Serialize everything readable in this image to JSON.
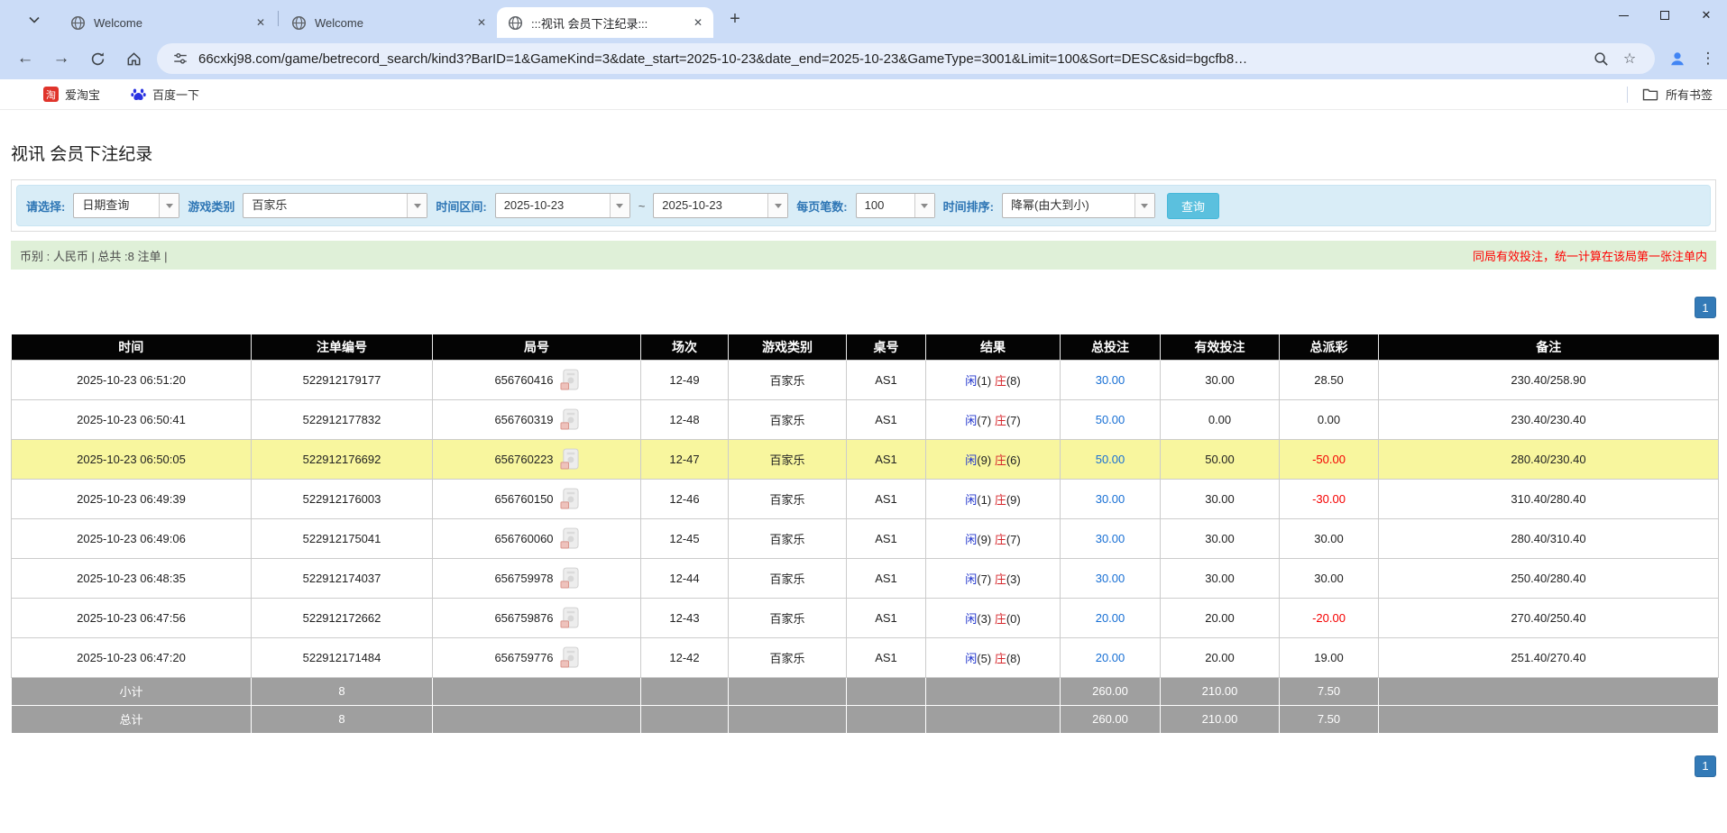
{
  "colors": {
    "player_blue": "#2135cd",
    "banker_red": "#d6262b",
    "amount_blue": "#176fd4",
    "negative_red": "#f50000",
    "highlight_yellow": "#f8f69e",
    "search_button_blue": "#5bc0de",
    "pagination_blue": "#337ab7",
    "filter_bar_blue": "#d9edf7",
    "info_bar_green": "#dff0d8",
    "header_black": "#040404"
  },
  "browser": {
    "tabs": [
      "Welcome",
      "Welcome",
      ":::视讯 会员下注纪录:::"
    ],
    "url": "66cxkj98.com/game/betrecord_search/kind3?BarID=1&GameKind=3&date_start=2025-10-23&date_end=2025-10-23&GameType=3001&Limit=100&Sort=DESC&sid=bgcfb8…",
    "bookmarks": {
      "items": [
        "爱淘宝",
        "百度一下"
      ],
      "all_bookmarks": "所有书签"
    }
  },
  "page": {
    "title": "视讯 会员下注纪录",
    "filter": {
      "select_label": "请选择:",
      "select_value": "日期查询",
      "game_type_label": "游戏类别",
      "game_type_value": "百家乐",
      "time_range_label": "时间区间:",
      "date_start": "2025-10-23",
      "range_separator": "~",
      "date_end": "2025-10-23",
      "page_size_label": "每页笔数:",
      "page_size_value": "100",
      "sort_label": "时间排序:",
      "sort_value": "降幂(由大到小)",
      "search_button": "查询"
    },
    "info_bar": {
      "left": "币别 : 人民币 | 总共 :8 注单 |",
      "right_notice": "同局有效投注，统一计算在该局第一张注单内"
    },
    "pagination": {
      "page": "1"
    },
    "table": {
      "headers": [
        "时间",
        "注单编号",
        "局号",
        "场次",
        "游戏类别",
        "桌号",
        "结果",
        "总投注",
        "有效投注",
        "总派彩",
        "备注"
      ],
      "rows": [
        {
          "time": "2025-10-23 06:51:20",
          "bet_no": "522912179177",
          "round_no": "656760416",
          "session": "12-49",
          "game": "百家乐",
          "table_no": "AS1",
          "result": {
            "player_label": "闲",
            "player_score": "1",
            "banker_label": "庄",
            "banker_score": "8"
          },
          "total_bet": "30.00",
          "valid_bet": "30.00",
          "payout": "28.50",
          "note": "230.40/258.90",
          "highlight": false
        },
        {
          "time": "2025-10-23 06:50:41",
          "bet_no": "522912177832",
          "round_no": "656760319",
          "session": "12-48",
          "game": "百家乐",
          "table_no": "AS1",
          "result": {
            "player_label": "闲",
            "player_score": "7",
            "banker_label": "庄",
            "banker_score": "7"
          },
          "total_bet": "50.00",
          "valid_bet": "0.00",
          "payout": "0.00",
          "note": "230.40/230.40",
          "highlight": false
        },
        {
          "time": "2025-10-23 06:50:05",
          "bet_no": "522912176692",
          "round_no": "656760223",
          "session": "12-47",
          "game": "百家乐",
          "table_no": "AS1",
          "result": {
            "player_label": "闲",
            "player_score": "9",
            "banker_label": "庄",
            "banker_score": "6"
          },
          "total_bet": "50.00",
          "valid_bet": "50.00",
          "payout": "-50.00",
          "note": "280.40/230.40",
          "highlight": true
        },
        {
          "time": "2025-10-23 06:49:39",
          "bet_no": "522912176003",
          "round_no": "656760150",
          "session": "12-46",
          "game": "百家乐",
          "table_no": "AS1",
          "result": {
            "player_label": "闲",
            "player_score": "1",
            "banker_label": "庄",
            "banker_score": "9"
          },
          "total_bet": "30.00",
          "valid_bet": "30.00",
          "payout": "-30.00",
          "note": "310.40/280.40",
          "highlight": false
        },
        {
          "time": "2025-10-23 06:49:06",
          "bet_no": "522912175041",
          "round_no": "656760060",
          "session": "12-45",
          "game": "百家乐",
          "table_no": "AS1",
          "result": {
            "player_label": "闲",
            "player_score": "9",
            "banker_label": "庄",
            "banker_score": "7"
          },
          "total_bet": "30.00",
          "valid_bet": "30.00",
          "payout": "30.00",
          "note": "280.40/310.40",
          "highlight": false
        },
        {
          "time": "2025-10-23 06:48:35",
          "bet_no": "522912174037",
          "round_no": "656759978",
          "session": "12-44",
          "game": "百家乐",
          "table_no": "AS1",
          "result": {
            "player_label": "闲",
            "player_score": "7",
            "banker_label": "庄",
            "banker_score": "3"
          },
          "total_bet": "30.00",
          "valid_bet": "30.00",
          "payout": "30.00",
          "note": "250.40/280.40",
          "highlight": false
        },
        {
          "time": "2025-10-23 06:47:56",
          "bet_no": "522912172662",
          "round_no": "656759876",
          "session": "12-43",
          "game": "百家乐",
          "table_no": "AS1",
          "result": {
            "player_label": "闲",
            "player_score": "3",
            "banker_label": "庄",
            "banker_score": "0"
          },
          "total_bet": "20.00",
          "valid_bet": "20.00",
          "payout": "-20.00",
          "note": "270.40/250.40",
          "highlight": false
        },
        {
          "time": "2025-10-23 06:47:20",
          "bet_no": "522912171484",
          "round_no": "656759776",
          "session": "12-42",
          "game": "百家乐",
          "table_no": "AS1",
          "result": {
            "player_label": "闲",
            "player_score": "5",
            "banker_label": "庄",
            "banker_score": "8"
          },
          "total_bet": "20.00",
          "valid_bet": "20.00",
          "payout": "19.00",
          "note": "251.40/270.40",
          "highlight": false
        }
      ],
      "summary_rows": [
        {
          "label": "小计",
          "count": "8",
          "total_bet": "260.00",
          "valid_bet": "210.00",
          "payout": "7.50"
        },
        {
          "label": "总计",
          "count": "8",
          "total_bet": "260.00",
          "valid_bet": "210.00",
          "payout": "7.50"
        }
      ]
    }
  }
}
